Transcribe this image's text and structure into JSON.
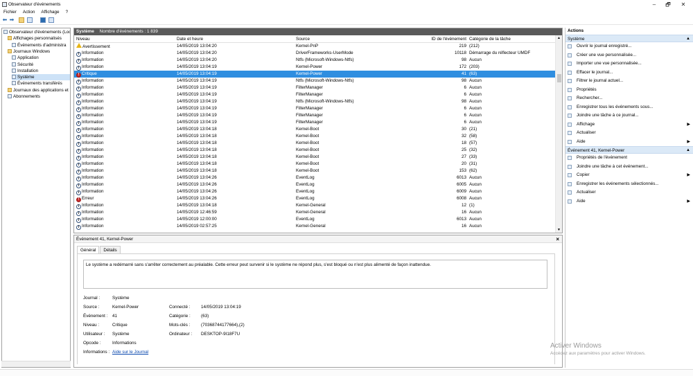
{
  "window": {
    "title": "Observateur d'événements",
    "minimize": "–",
    "maximize": "🗗",
    "close": "✕"
  },
  "menu": [
    "Fichier",
    "Action",
    "Affichage",
    "?"
  ],
  "tree": [
    {
      "label": "Observateur d'événements (Loc",
      "indent": 0,
      "folder": false,
      "sel": false
    },
    {
      "label": "Affichages personnalisés",
      "indent": 1,
      "folder": true,
      "sel": false
    },
    {
      "label": "Événements d'administra",
      "indent": 2,
      "folder": false,
      "sel": false
    },
    {
      "label": "Journaux Windows",
      "indent": 1,
      "folder": true,
      "sel": false
    },
    {
      "label": "Application",
      "indent": 2,
      "folder": false,
      "sel": false
    },
    {
      "label": "Sécurité",
      "indent": 2,
      "folder": false,
      "sel": false
    },
    {
      "label": "Installation",
      "indent": 2,
      "folder": false,
      "sel": false
    },
    {
      "label": "Système",
      "indent": 2,
      "folder": false,
      "sel": true
    },
    {
      "label": "Événements transférés",
      "indent": 2,
      "folder": false,
      "sel": false
    },
    {
      "label": "Journaux des applications et",
      "indent": 1,
      "folder": true,
      "sel": false
    },
    {
      "label": "Abonnements",
      "indent": 1,
      "folder": false,
      "sel": false
    }
  ],
  "log": {
    "name": "Système",
    "count_label": "Nombre d'événements : 1 839"
  },
  "columns": {
    "level": "Niveau",
    "date": "Date et heure",
    "source": "Source",
    "id": "ID de l'événement",
    "category": "Catégorie de la tâche"
  },
  "events": [
    {
      "type": "warn",
      "level": "Avertissement",
      "date": "14/05/2019 13:04:20",
      "source": "Kernel-PnP",
      "id": "219",
      "category": "(212)",
      "hl": false
    },
    {
      "type": "info",
      "level": "Information",
      "date": "14/05/2019 13:04:20",
      "source": "DriverFrameworks-UserMode",
      "id": "10118",
      "category": "Démarrage du réflecteur UMDF",
      "hl": false
    },
    {
      "type": "info",
      "level": "Information",
      "date": "14/05/2019 13:04:20",
      "source": "Ntfs (Microsoft-Windows-Ntfs)",
      "id": "98",
      "category": "Aucun",
      "hl": false
    },
    {
      "type": "info",
      "level": "Information",
      "date": "14/05/2019 13:04:19",
      "source": "Kernel-Power",
      "id": "172",
      "category": "(203)",
      "hl": false
    },
    {
      "type": "err",
      "level": "Critique",
      "date": "14/05/2019 13:04:19",
      "source": "Kernel-Power",
      "id": "41",
      "category": "(63)",
      "hl": true
    },
    {
      "type": "info",
      "level": "Information",
      "date": "14/05/2019 13:04:19",
      "source": "Ntfs (Microsoft-Windows-Ntfs)",
      "id": "98",
      "category": "Aucun",
      "hl": false
    },
    {
      "type": "info",
      "level": "Information",
      "date": "14/05/2019 13:04:19",
      "source": "FilterManager",
      "id": "6",
      "category": "Aucun",
      "hl": false
    },
    {
      "type": "info",
      "level": "Information",
      "date": "14/05/2019 13:04:19",
      "source": "FilterManager",
      "id": "6",
      "category": "Aucun",
      "hl": false
    },
    {
      "type": "info",
      "level": "Information",
      "date": "14/05/2019 13:04:19",
      "source": "Ntfs (Microsoft-Windows-Ntfs)",
      "id": "98",
      "category": "Aucun",
      "hl": false
    },
    {
      "type": "info",
      "level": "Information",
      "date": "14/05/2019 13:04:19",
      "source": "FilterManager",
      "id": "6",
      "category": "Aucun",
      "hl": false
    },
    {
      "type": "info",
      "level": "Information",
      "date": "14/05/2019 13:04:19",
      "source": "FilterManager",
      "id": "6",
      "category": "Aucun",
      "hl": false
    },
    {
      "type": "info",
      "level": "Information",
      "date": "14/05/2019 13:04:19",
      "source": "FilterManager",
      "id": "6",
      "category": "Aucun",
      "hl": false
    },
    {
      "type": "info",
      "level": "Information",
      "date": "14/05/2019 13:04:18",
      "source": "Kernel-Boot",
      "id": "30",
      "category": "(21)",
      "hl": false
    },
    {
      "type": "info",
      "level": "Information",
      "date": "14/05/2019 13:04:18",
      "source": "Kernel-Boot",
      "id": "32",
      "category": "(58)",
      "hl": false
    },
    {
      "type": "info",
      "level": "Information",
      "date": "14/05/2019 13:04:18",
      "source": "Kernel-Boot",
      "id": "18",
      "category": "(57)",
      "hl": false
    },
    {
      "type": "info",
      "level": "Information",
      "date": "14/05/2019 13:04:18",
      "source": "Kernel-Boot",
      "id": "25",
      "category": "(32)",
      "hl": false
    },
    {
      "type": "info",
      "level": "Information",
      "date": "14/05/2019 13:04:18",
      "source": "Kernel-Boot",
      "id": "27",
      "category": "(33)",
      "hl": false
    },
    {
      "type": "info",
      "level": "Information",
      "date": "14/05/2019 13:04:18",
      "source": "Kernel-Boot",
      "id": "20",
      "category": "(31)",
      "hl": false
    },
    {
      "type": "info",
      "level": "Information",
      "date": "14/05/2019 13:04:18",
      "source": "Kernel-Boot",
      "id": "153",
      "category": "(62)",
      "hl": false
    },
    {
      "type": "info",
      "level": "Information",
      "date": "14/05/2019 13:04:26",
      "source": "EventLog",
      "id": "6013",
      "category": "Aucun",
      "hl": false
    },
    {
      "type": "info",
      "level": "Information",
      "date": "14/05/2019 13:04:26",
      "source": "EventLog",
      "id": "6005",
      "category": "Aucun",
      "hl": false
    },
    {
      "type": "info",
      "level": "Information",
      "date": "14/05/2019 13:04:26",
      "source": "EventLog",
      "id": "6009",
      "category": "Aucun",
      "hl": false
    },
    {
      "type": "err",
      "level": "Erreur",
      "date": "14/05/2019 13:04:26",
      "source": "EventLog",
      "id": "6008",
      "category": "Aucun",
      "hl": false
    },
    {
      "type": "info",
      "level": "Information",
      "date": "14/05/2019 13:04:18",
      "source": "Kernel-General",
      "id": "12",
      "category": "(1)",
      "hl": false
    },
    {
      "type": "info",
      "level": "Information",
      "date": "14/05/2019 12:46:59",
      "source": "Kernel-General",
      "id": "16",
      "category": "Aucun",
      "hl": false
    },
    {
      "type": "info",
      "level": "Information",
      "date": "14/05/2019 12:00:00",
      "source": "EventLog",
      "id": "6013",
      "category": "Aucun",
      "hl": false
    },
    {
      "type": "info",
      "level": "Information",
      "date": "14/05/2019 02:57:25",
      "source": "Kernel-General",
      "id": "16",
      "category": "Aucun",
      "hl": false
    }
  ],
  "detail": {
    "title": "Événement 41, Kernel-Power",
    "close": "×",
    "tab_general": "Général",
    "tab_details": "Détails",
    "message": "Le système a redémarré sans s'arrêter correctement au préalable. Cette erreur peut survenir si le système ne répond plus, s'est bloqué ou n'est plus alimenté de façon inattendue.",
    "journal_label": "Journal :",
    "journal": "Système",
    "source_label": "Source :",
    "source": "Kernel-Power",
    "connected_label": "Connecté :",
    "connected": "14/05/2019 13:04:19",
    "event_label": "Événement :",
    "event": "41",
    "category_label": "Catégorie :",
    "category": "(63)",
    "level_label": "Niveau :",
    "level": "Critique",
    "keywords_label": "Mots-clés :",
    "keywords": "(70368744177664),(2)",
    "user_label": "Utilisateur :",
    "user": "Système",
    "computer_label": "Ordinateur :",
    "computer": "DESKTOP-9I18F7U",
    "opcode_label": "Opcode :",
    "opcode": "Informations",
    "info_label": "Informations :",
    "info_link": "Aide sur le Journal"
  },
  "actions": {
    "header": "Actions",
    "section1": "Système",
    "items1": [
      {
        "label": "Ouvrir le journal enregistré...",
        "arrow": false
      },
      {
        "label": "Créer une vue personnalisée...",
        "arrow": false
      },
      {
        "label": "Importer une vue personnalisée...",
        "arrow": false
      },
      {
        "label": "Effacer le journal...",
        "arrow": false
      },
      {
        "label": "Filtrer le journal actuel...",
        "arrow": false
      },
      {
        "label": "Propriétés",
        "arrow": false
      },
      {
        "label": "Rechercher...",
        "arrow": false
      },
      {
        "label": "Enregistrer tous les événements sous...",
        "arrow": false
      },
      {
        "label": "Joindre une tâche à ce journal...",
        "arrow": false
      },
      {
        "label": "Affichage",
        "arrow": true
      },
      {
        "label": "Actualiser",
        "arrow": false
      },
      {
        "label": "Aide",
        "arrow": true
      }
    ],
    "section2": "Événement 41, Kernel-Power",
    "items2": [
      {
        "label": "Propriétés de l'événement",
        "arrow": false
      },
      {
        "label": "Joindre une tâche à cet événement...",
        "arrow": false
      },
      {
        "label": "Copier",
        "arrow": true
      },
      {
        "label": "Enregistrer les événements sélectionnés...",
        "arrow": false
      },
      {
        "label": "Actualiser",
        "arrow": false
      },
      {
        "label": "Aide",
        "arrow": true
      }
    ]
  },
  "watermark": {
    "line1": "Activer Windows",
    "line2": "Accédez aux paramètres pour activer Windows."
  }
}
